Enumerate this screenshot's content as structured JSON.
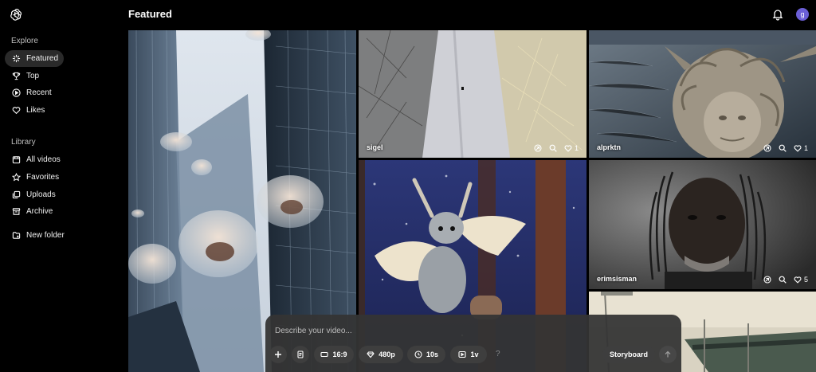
{
  "header": {
    "title": "Featured",
    "avatar_initial": "g"
  },
  "sidebar": {
    "explore_label": "Explore",
    "explore_items": [
      {
        "label": "Featured",
        "icon": "sparkle-icon",
        "active": true
      },
      {
        "label": "Top",
        "icon": "trophy-icon"
      },
      {
        "label": "Recent",
        "icon": "play-circle-icon"
      },
      {
        "label": "Likes",
        "icon": "heart-icon"
      }
    ],
    "library_label": "Library",
    "library_items": [
      {
        "label": "All videos",
        "icon": "video-library-icon"
      },
      {
        "label": "Favorites",
        "icon": "star-icon"
      },
      {
        "label": "Uploads",
        "icon": "uploads-icon"
      },
      {
        "label": "Archive",
        "icon": "archive-icon"
      }
    ],
    "new_folder": {
      "label": "New folder",
      "icon": "new-folder-icon"
    }
  },
  "grid": {
    "tiles": [
      {
        "user": "",
        "likes": ""
      },
      {
        "user": "sigel",
        "likes": "1"
      },
      {
        "user": "alprktn",
        "likes": "1"
      },
      {
        "user": "",
        "likes": ""
      },
      {
        "user": "erimsisman",
        "likes": "5"
      },
      {
        "user": "",
        "likes": ""
      }
    ]
  },
  "composer": {
    "placeholder": "Describe your video...",
    "aspect": "16:9",
    "resolution": "480p",
    "duration": "10s",
    "variations": "1v",
    "help": "?",
    "storyboard": "Storyboard"
  },
  "colors": {
    "background": "#000000",
    "composer": "#343434",
    "chip": "#3e3e3e",
    "avatar": "#6b5fd6"
  }
}
